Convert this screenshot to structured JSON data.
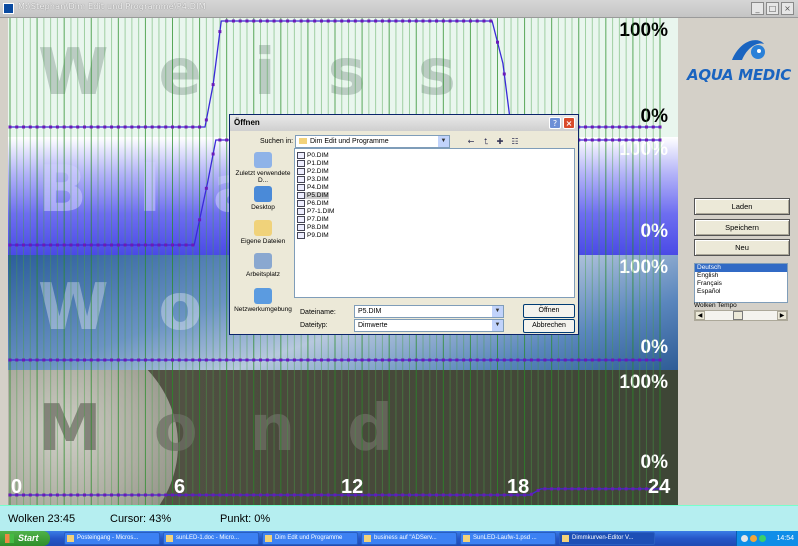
{
  "window": {
    "title": "M:\\Stephan\\Dim Edit und Programme\\P4.DIM",
    "buttons": [
      "_",
      "□",
      "×"
    ]
  },
  "bands": [
    {
      "id": "weiss",
      "watermark": "Weiss",
      "top_label": "100%",
      "bottom_label": "0%",
      "color": "#e9f6ee"
    },
    {
      "id": "blau",
      "watermark": "Blau",
      "top_label": "100%",
      "bottom_label": "0%",
      "color": "#6e6ef0"
    },
    {
      "id": "wolken",
      "watermark": "Wolken",
      "top_label": "100%",
      "bottom_label": "0%",
      "color": "#4a7ab8"
    },
    {
      "id": "mond",
      "watermark": "Mond",
      "top_label": "100%",
      "bottom_label": "0%",
      "color": "#4a4a3c"
    }
  ],
  "hour_labels": [
    "0",
    "6",
    "12",
    "18",
    "24"
  ],
  "chart_data": {
    "type": "line",
    "x_unit": "hour",
    "xlim": [
      0,
      24
    ],
    "ylim": [
      0,
      100
    ],
    "series": [
      {
        "band": "weiss",
        "x": [
          0,
          7.2,
          7.5,
          7.8,
          17.8,
          18.2,
          18.5,
          24
        ],
        "values": [
          0,
          0,
          40,
          100,
          100,
          60,
          0,
          0
        ]
      },
      {
        "band": "blau",
        "x": [
          0,
          6.8,
          7.3,
          7.6,
          24
        ],
        "values": [
          0,
          0,
          60,
          100,
          100
        ]
      },
      {
        "band": "wolken",
        "x": [
          0,
          24
        ],
        "values": [
          0,
          0
        ]
      },
      {
        "band": "mond",
        "x": [
          0,
          6.8,
          7.0,
          19.2,
          19.6,
          24
        ],
        "values": [
          0,
          0,
          0,
          0,
          5,
          5
        ]
      }
    ]
  },
  "panel": {
    "logo_text": "AQUA MEDIC",
    "buttons": {
      "load": "Laden",
      "save": "Speichern",
      "new": "Neu"
    },
    "languages": [
      "Deutsch",
      "English",
      "Français",
      "Español"
    ],
    "selected_language": "Deutsch",
    "tempo_label": "Wolken Tempo"
  },
  "status": {
    "wolken": "Wolken  23:45",
    "cursor": "Cursor: 43%",
    "punkt": "Punkt: 0%"
  },
  "dialog": {
    "title": "Öffnen",
    "look_in_label": "Suchen in:",
    "look_in_value": "Dim Edit und Programme",
    "places": [
      "Zuletzt verwendete D...",
      "Desktop",
      "Eigene Dateien",
      "Arbeitsplatz",
      "Netzwerkumgebung"
    ],
    "files": [
      "P0.DIM",
      "P1.DIM",
      "P2.DIM",
      "P3.DIM",
      "P4.DIM",
      "P5.DIM",
      "P6.DIM",
      "P7-1.DIM",
      "P7.DIM",
      "P8.DIM",
      "P9.DIM"
    ],
    "selected_file": "P5.DIM",
    "filename_label": "Dateiname:",
    "filename_value": "P5.DIM",
    "filetype_label": "Dateityp:",
    "filetype_value": "Dimwerte",
    "open_button": "Öffnen",
    "cancel_button": "Abbrechen",
    "help": "?",
    "close": "×"
  },
  "taskbar": {
    "start": "Start",
    "tasks": [
      "Posteingang - Micros...",
      "sunLED-1.doc - Micro...",
      "Dim Edit und Programme",
      "business auf \"ADServ...",
      "SunLED-Laufw-1.psd ...",
      "Dimmkurven-Editor V..."
    ],
    "active_task": "Dimmkurven-Editor V...",
    "clock": "14:54"
  }
}
